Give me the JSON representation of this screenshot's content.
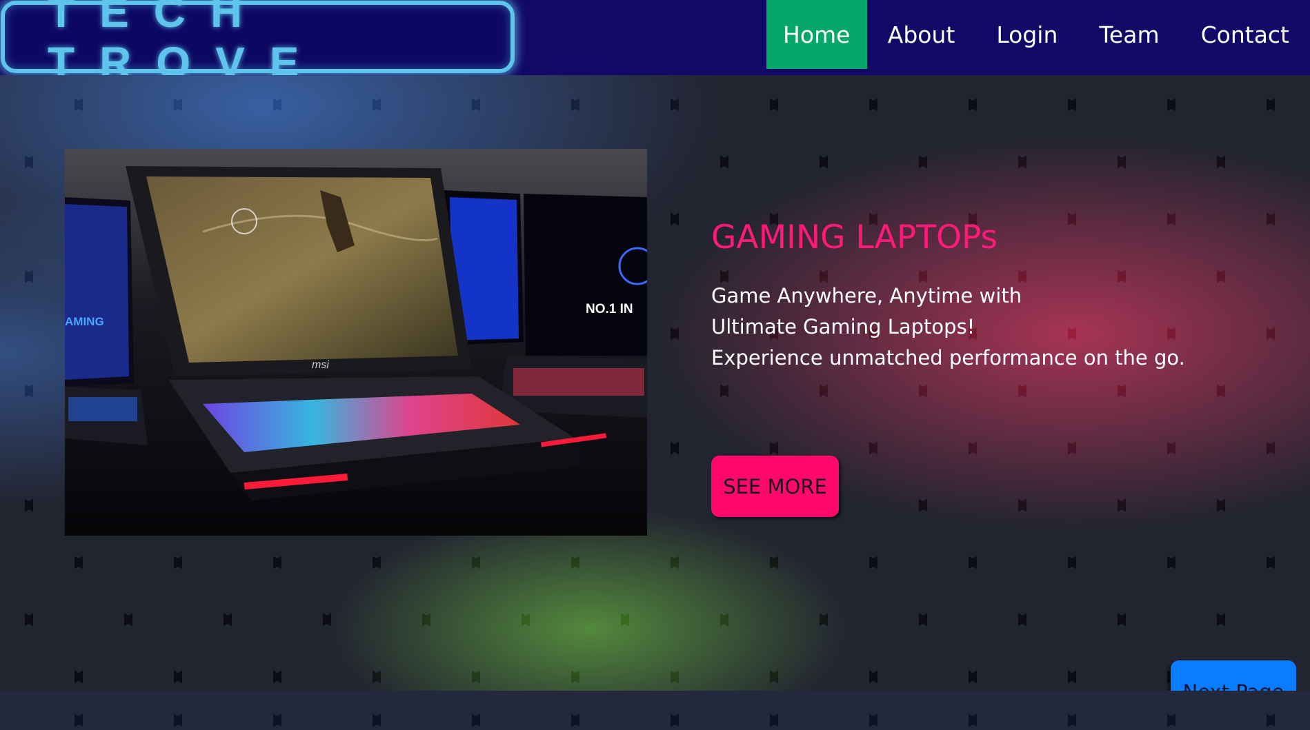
{
  "header": {
    "logo_text": "TECH TROVE",
    "nav": [
      {
        "label": "Home",
        "active": true
      },
      {
        "label": "About"
      },
      {
        "label": "Login"
      },
      {
        "label": "Team"
      },
      {
        "label": "Contact"
      }
    ]
  },
  "hero": {
    "image_text": {
      "laptop_logo": "msi",
      "left_screen": "AMING",
      "right_screen": "NO.1 IN"
    },
    "title": "GAMING LAPTOPs",
    "description": [
      "Game Anywhere, Anytime with",
      "Ultimate Gaming Laptops!",
      "Experience unmatched performance on the go."
    ],
    "see_more_label": "SEE MORE",
    "next_page_label": "Next Page"
  },
  "colors": {
    "navbar_bg": "#120866",
    "logo_accent": "#5fc4ec",
    "active_nav_bg": "#05a66a",
    "title_color": "#ff1a7a",
    "see_more_bg": "#ff0a6c",
    "next_page_bg": "#0a7cff",
    "hex_glow_blue": "#2f7dff",
    "hex_glow_red": "#ff1e4c",
    "hex_glow_green": "#66d41c"
  }
}
